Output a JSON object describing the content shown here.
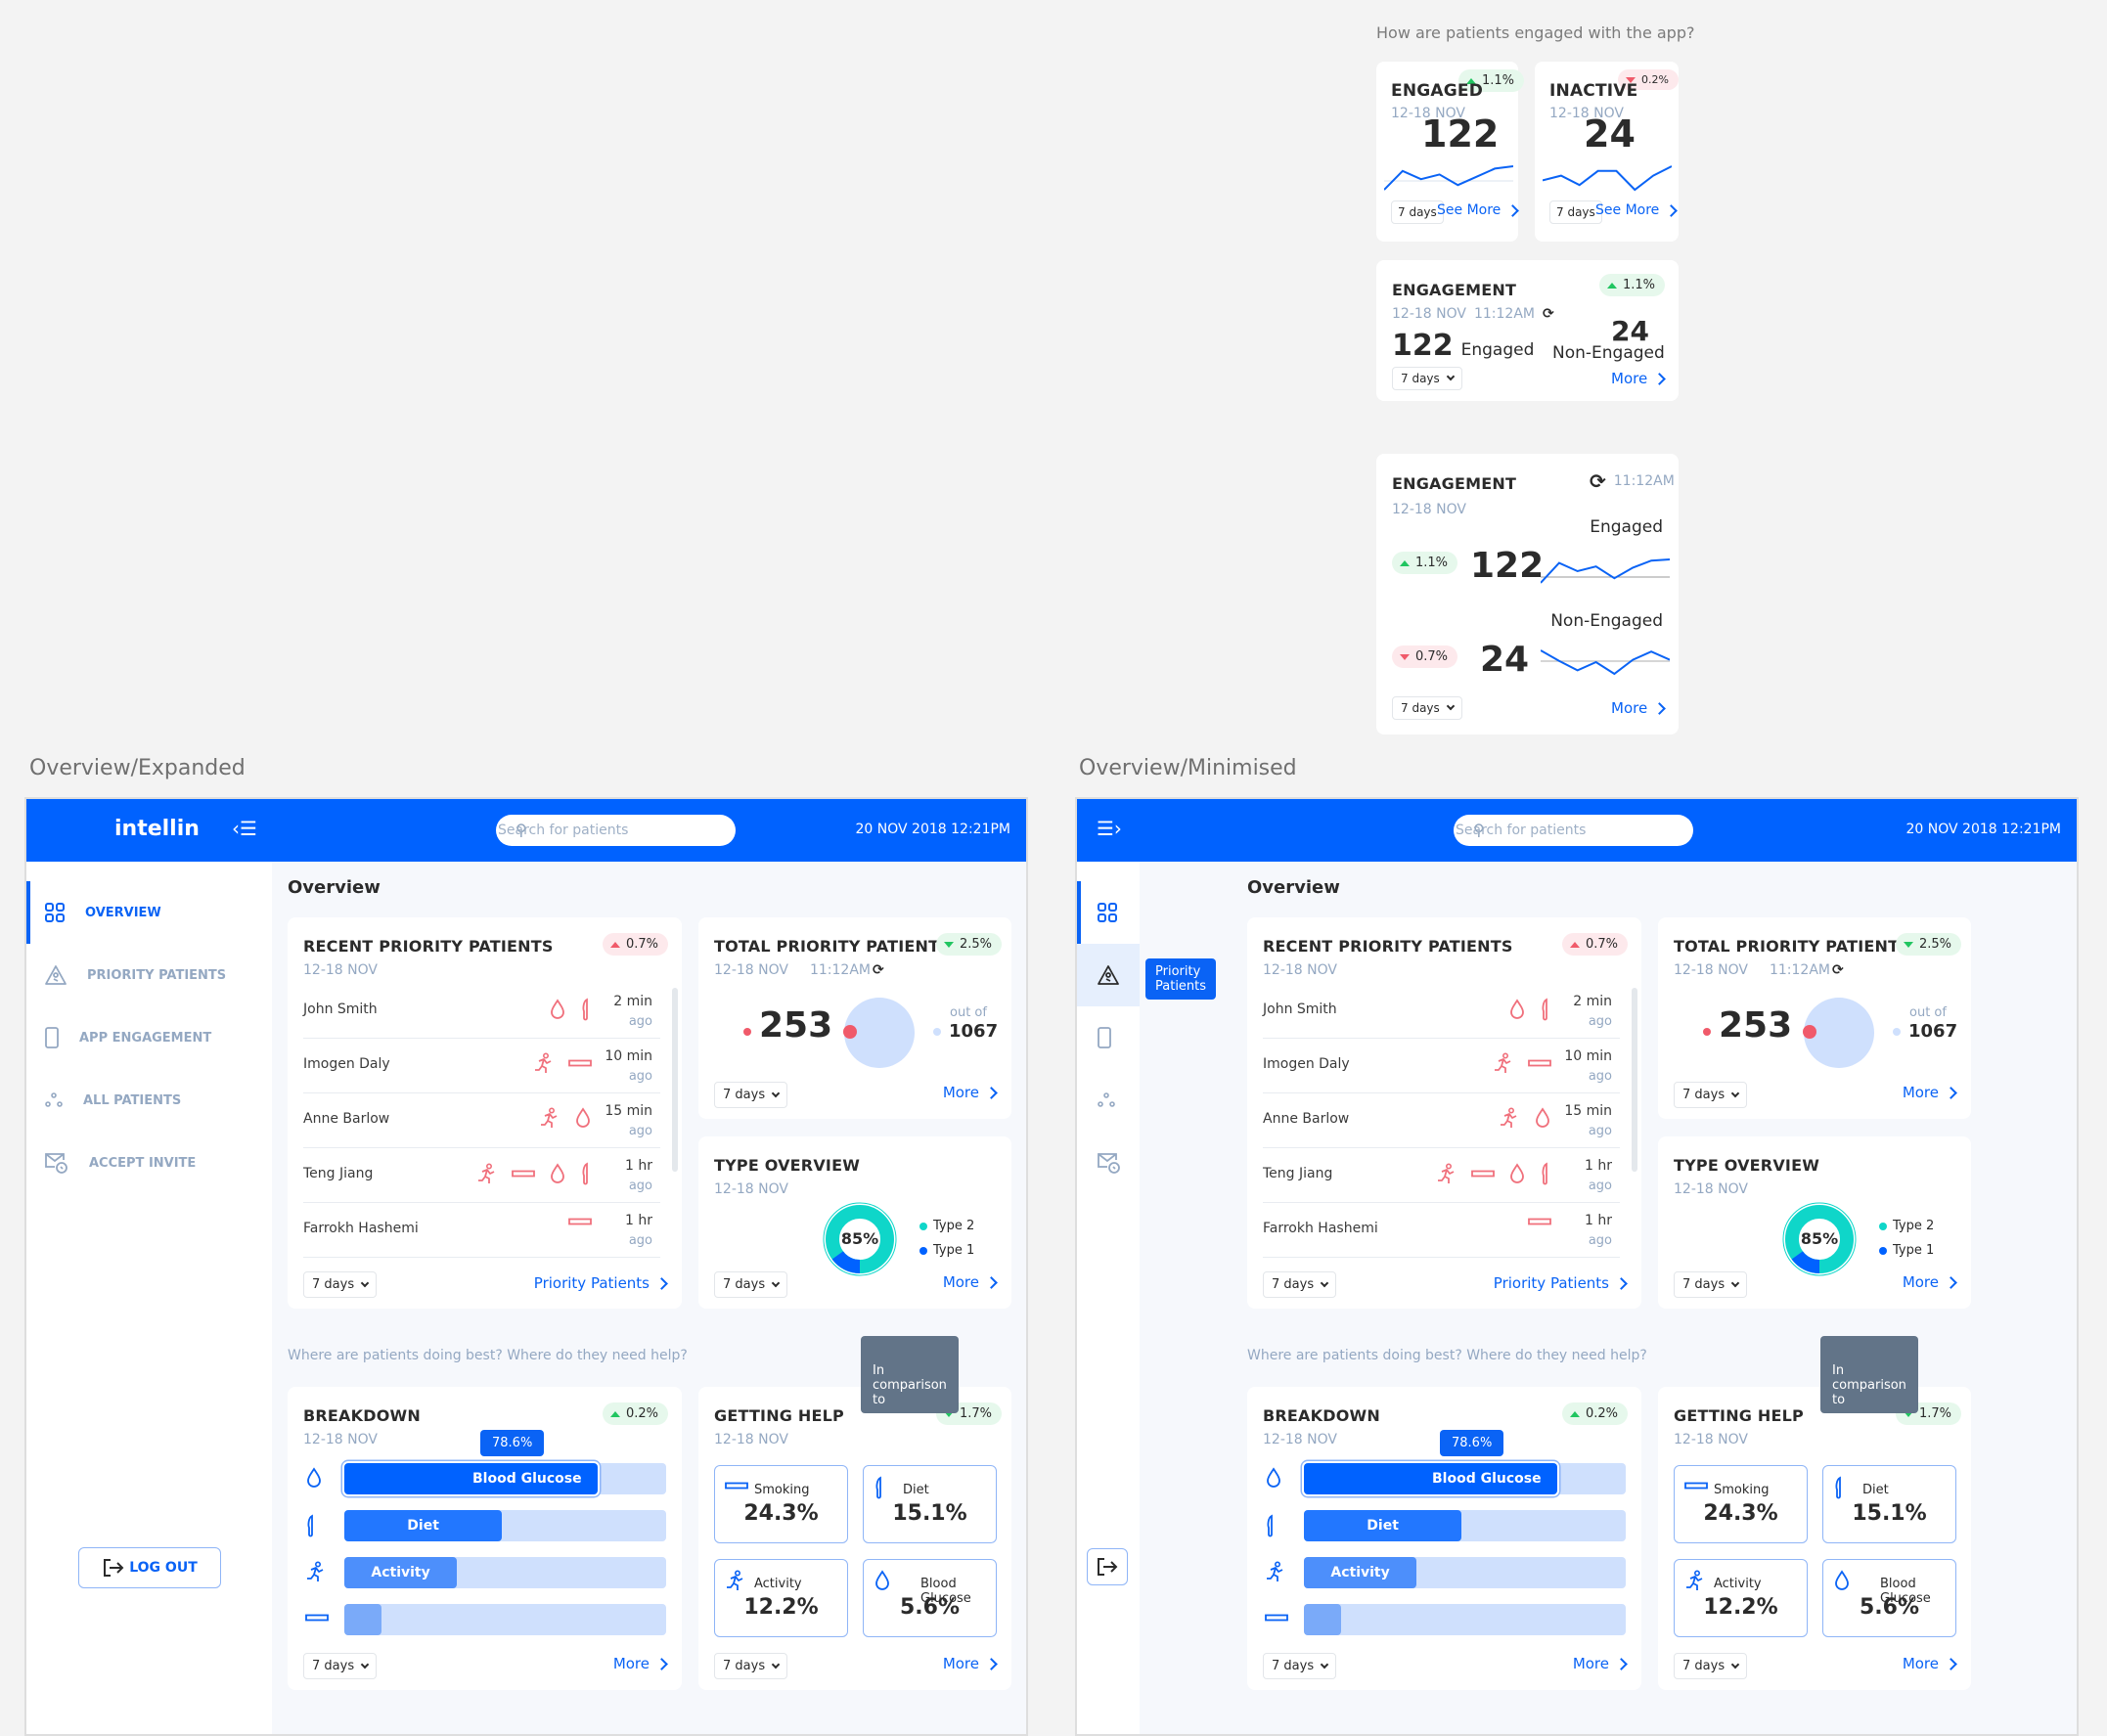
{
  "engagement_widgets": {
    "question": "How are patients engaged with the app?",
    "engaged_card": {
      "title": "ENGAGED",
      "date": "12-18 NOV",
      "value": "122",
      "change": "1.1%",
      "trend": "up",
      "period": "7 days",
      "link": "See More",
      "sparkline": [
        0.1,
        0.9,
        0.55,
        0.75,
        0.3,
        0.65,
        1.0,
        1.1
      ]
    },
    "inactive_card": {
      "title": "INACTIVE",
      "date": "12-18 NOV",
      "value": "24",
      "change": "0.2%",
      "trend": "down",
      "period": "7 days",
      "link": "See More",
      "sparkline": [
        0.5,
        0.55,
        0.45,
        0.6,
        0.6,
        0.4,
        0.55,
        0.65
      ]
    },
    "engagement_compact": {
      "title": "ENGAGEMENT",
      "date": "12-18 NOV",
      "time": "11:12AM",
      "change": "1.1%",
      "trend": "up",
      "engaged_value": "122",
      "engaged_label": "Engaged",
      "nonengaged_value": "24",
      "nonengaged_label": "Non-Engaged",
      "period": "7 days",
      "link": "More"
    },
    "engagement_detail": {
      "title": "ENGAGEMENT",
      "date": "12-18 NOV",
      "time": "11:12AM",
      "engaged": {
        "label": "Engaged",
        "value": "122",
        "change": "1.1%",
        "trend": "up",
        "sparkline": [
          0.0,
          0.85,
          0.5,
          0.7,
          0.2,
          0.65,
          0.95,
          1.0
        ]
      },
      "nonengaged": {
        "label": "Non-Engaged",
        "value": "24",
        "change": "0.7%",
        "trend": "down",
        "sparkline": [
          1.0,
          0.55,
          0.15,
          0.5,
          0.0,
          0.6,
          0.95,
          0.6
        ]
      },
      "period": "7 days",
      "link": "More"
    }
  },
  "frames": {
    "expanded_label": "Overview/Expanded",
    "minimised_label": "Overview/Minimised"
  },
  "app": {
    "logo": "intellin",
    "search_placeholder": "Search for patients",
    "datetime": "20 NOV 2018  12:21PM",
    "page_title": "Overview",
    "nav": [
      {
        "label": "OVERVIEW",
        "icon": "grid-icon",
        "active": true
      },
      {
        "label": "PRIORITY PATIENTS",
        "icon": "warning-triangle-icon",
        "active": false
      },
      {
        "label": "APP ENGAGEMENT",
        "icon": "phone-icon",
        "active": false
      },
      {
        "label": "ALL PATIENTS",
        "icon": "people-dots-icon",
        "active": false
      },
      {
        "label": "ACCEPT INVITE",
        "icon": "mail-clock-icon",
        "active": false
      }
    ],
    "logout_label": "LOG OUT",
    "nav_tooltip": "Priority Patients",
    "recent": {
      "title": "RECENT PRIORITY PATIENTS",
      "date": "12-18 NOV",
      "change": "0.7%",
      "trend": "up",
      "rows": [
        {
          "name": "John Smith",
          "icons": [
            "blood-drop-icon",
            "diet-icon"
          ],
          "time": "2 min",
          "ago": "ago"
        },
        {
          "name": "Imogen Daly",
          "icons": [
            "activity-icon",
            "smoking-icon"
          ],
          "time": "10 min",
          "ago": "ago"
        },
        {
          "name": "Anne Barlow",
          "icons": [
            "activity-icon",
            "blood-drop-icon"
          ],
          "time": "15 min",
          "ago": "ago"
        },
        {
          "name": "Teng Jiang",
          "icons": [
            "activity-icon",
            "smoking-icon",
            "blood-drop-icon",
            "diet-icon"
          ],
          "time": "1 hr",
          "ago": "ago"
        },
        {
          "name": "Farrokh Hashemi",
          "icons": [
            "smoking-icon"
          ],
          "time": "1 hr",
          "ago": "ago"
        }
      ],
      "period": "7 days",
      "link": "Priority Patients"
    },
    "total": {
      "title": "TOTAL PRIORITY PATIENTS",
      "date": "12-18 NOV",
      "time": "11:12AM",
      "change": "2.5%",
      "trend": "down",
      "value": "253",
      "out_of_label": "out of",
      "total": "1067",
      "period": "7 days",
      "link": "More"
    },
    "type": {
      "title": "TYPE OVERVIEW",
      "date": "12-18 NOV",
      "center": "85%",
      "legend": [
        "Type 2",
        "Type 1"
      ],
      "type2_fraction": 0.85,
      "period": "7 days",
      "link": "More"
    },
    "section_question": "Where are patients doing best? Where do they need help?",
    "breakdown": {
      "title": "BREAKDOWN",
      "date": "12-18 NOV",
      "change": "0.2%",
      "trend": "up",
      "tooltip": "78.6%",
      "bars": [
        {
          "label": "Blood Glucose",
          "icon": "blood-drop-icon",
          "fraction": 0.786,
          "color": "#0062ff"
        },
        {
          "label": "Diet",
          "icon": "diet-icon",
          "fraction": 0.49,
          "color": "#2277ff"
        },
        {
          "label": "Activity",
          "icon": "activity-icon",
          "fraction": 0.35,
          "color": "#4d8ffb"
        },
        {
          "label": "",
          "icon": "smoking-icon",
          "fraction": 0.115,
          "color": "#7aaaf9"
        }
      ],
      "period": "7 days",
      "link": "More"
    },
    "getting_help": {
      "title": "GETTING HELP",
      "date": "12-18 NOV",
      "change": "1.7%",
      "trend": "down",
      "tooltip": "In comparison to",
      "items": [
        {
          "label": "Smoking",
          "value": "24.3%",
          "icon": "smoking-icon"
        },
        {
          "label": "Diet",
          "value": "15.1%",
          "icon": "diet-icon"
        },
        {
          "label": "Activity",
          "value": "12.2%",
          "icon": "activity-icon"
        },
        {
          "label": "Blood Glucose",
          "value": "5.6%",
          "icon": "blood-drop-icon"
        }
      ],
      "period": "7 days",
      "link": "More"
    }
  },
  "colors": {
    "brand": "#0062ff",
    "positive": "#21c560",
    "negative": "#f05a6a",
    "type2": "#0fd6c9",
    "type1": "#0062ff",
    "muted": "#94a8c2"
  }
}
